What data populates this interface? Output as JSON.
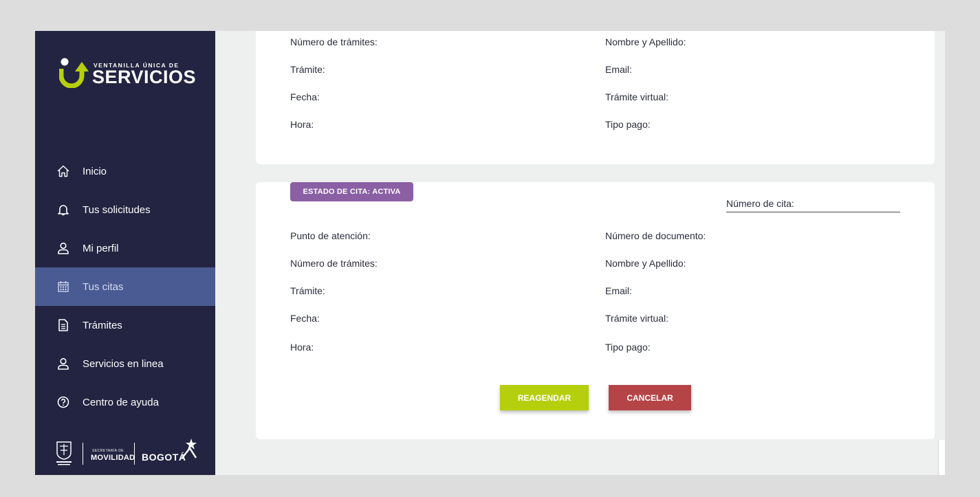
{
  "brand": {
    "small": "VENTANILLA ÚNICA DE",
    "big": "SERVICIOS",
    "accent": "#b6cf0d"
  },
  "sidebar": {
    "items": [
      {
        "label": "Inicio",
        "icon": "home-icon"
      },
      {
        "label": "Tus solicitudes",
        "icon": "bell-icon"
      },
      {
        "label": "Mi perfil",
        "icon": "user-icon"
      },
      {
        "label": "Tus citas",
        "icon": "calendar-icon",
        "active": true
      },
      {
        "label": "Trámites",
        "icon": "document-icon"
      },
      {
        "label": "Servicios en linea",
        "icon": "user-icon"
      },
      {
        "label": "Centro de ayuda",
        "icon": "help-circle-icon"
      }
    ],
    "footer": {
      "secretaria": "SECRETARÍA DE",
      "movilidad": "MOVILIDAD",
      "bogota": "BOGOTÁ"
    }
  },
  "card1": {
    "fields": [
      "Número de trámites:",
      "Nombre y Apellido:",
      "Trámite:",
      "Email:",
      "Fecha:",
      "Trámite virtual:",
      "Hora:",
      "Tipo pago:"
    ]
  },
  "card2": {
    "status": "ESTADO DE CITA: ACTIVA",
    "status_color": "#8a5fa3",
    "numero_cita_label": "Número de cita:",
    "fields": [
      "Punto de atención:",
      "Número de documento:",
      "Número de trámites:",
      "Nombre y Apellido:",
      "Trámite:",
      "Email:",
      "Fecha:",
      "Trámite virtual:",
      "Hora:",
      "Tipo pago:"
    ],
    "buttons": {
      "reagendar": "REAGENDAR",
      "cancelar": "CANCELAR"
    },
    "colors": {
      "reagendar": "#b6cf0d",
      "cancelar": "#b54447"
    }
  }
}
